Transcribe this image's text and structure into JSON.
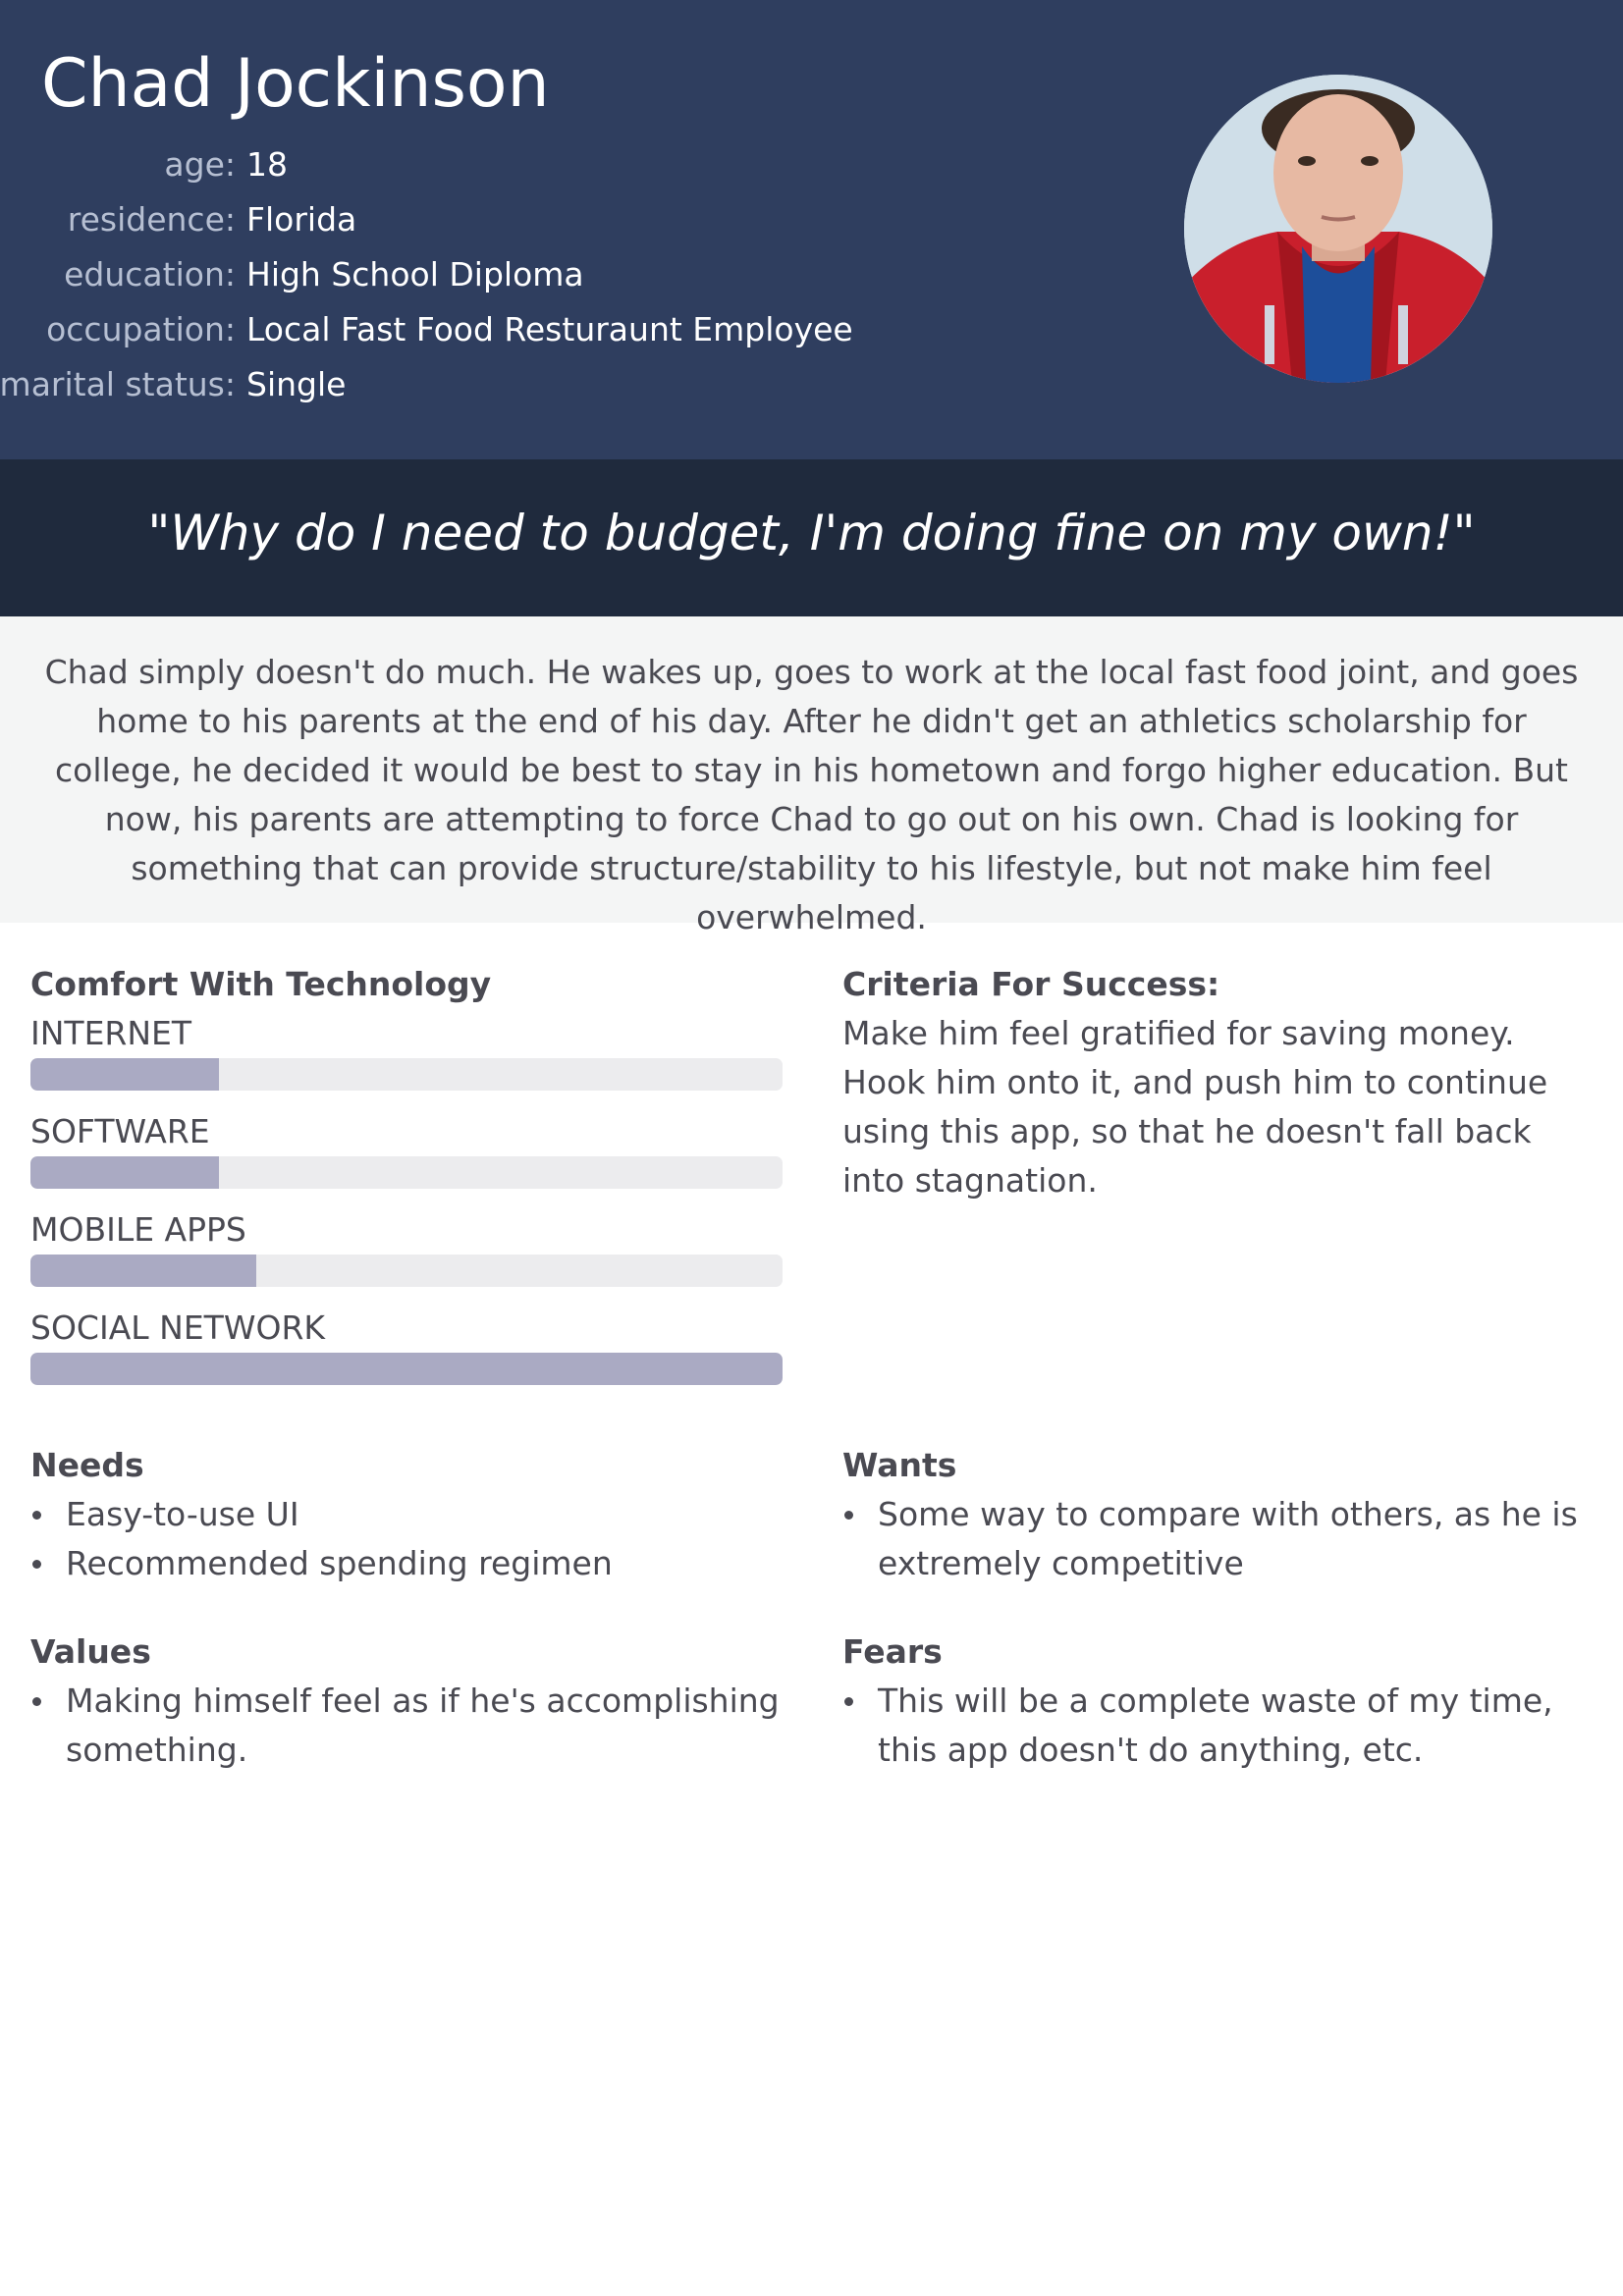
{
  "persona": {
    "name": "Chad Jockinson",
    "facts": [
      {
        "label": "age:",
        "value": "18"
      },
      {
        "label": "residence:",
        "value": "Florida"
      },
      {
        "label": "education:",
        "value": "High School Diploma"
      },
      {
        "label": "occupation:",
        "value": "Local Fast Food Resturaunt Employee"
      },
      {
        "label": "marital status:",
        "value": "Single"
      }
    ]
  },
  "quote": "\"Why do I need to budget, I'm doing fine on my own!\"",
  "bio": "Chad simply doesn't do much. He wakes up, goes to work at the local fast food joint, and goes home to his parents at the end of his day. After he didn't get an athletics scholarship for college, he decided it would be best to stay in his hometown and forgo higher education. But now, his parents are attempting to force Chad to go out on his own. Chad is looking for something that can provide structure/stability to his lifestyle, but not make him feel overwhelmed.",
  "comfort": {
    "heading": "Comfort With Technology",
    "skills": [
      {
        "label": "INTERNET",
        "level": 0.25
      },
      {
        "label": "SOFTWARE",
        "level": 0.25
      },
      {
        "label": "MOBILE APPS",
        "level": 0.3
      },
      {
        "label": "SOCIAL NETWORK",
        "level": 1.0
      }
    ]
  },
  "criteria": {
    "heading": "Criteria For Success:",
    "text": "Make him feel gratified for saving money. Hook him onto it, and push him to continue using this app, so that he doesn't fall back into stagnation."
  },
  "needs": {
    "heading": "Needs",
    "items": [
      "Easy-to-use UI",
      "Recommended spending regimen"
    ]
  },
  "wants": {
    "heading": "Wants",
    "items": [
      "Some way to compare with others, as he is extremely competitive"
    ]
  },
  "values": {
    "heading": "Values",
    "items": [
      "Making himself feel as if he's accomplishing something."
    ]
  },
  "fears": {
    "heading": "Fears",
    "items": [
      "This will be a complete waste of my time, this app doesn't do anything, etc."
    ]
  },
  "colors": {
    "header_bg": "#2f3e5f",
    "quote_bg": "#1f2a3d",
    "bio_bg": "#f4f5f5",
    "bar_fill": "#aaaac3",
    "bar_track": "#ececee"
  }
}
